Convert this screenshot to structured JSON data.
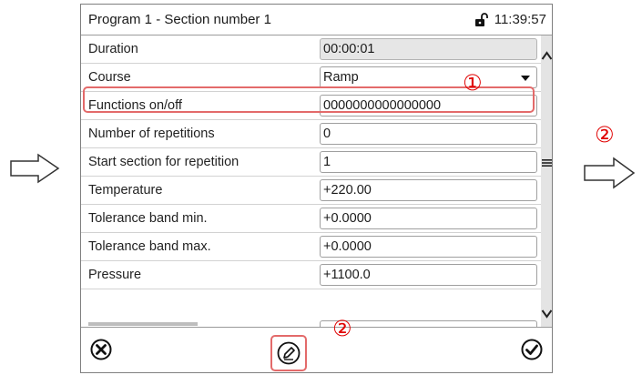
{
  "window": {
    "title": "Program 1 - Section number 1",
    "time": "11:39:57"
  },
  "rows": [
    {
      "label": "Duration",
      "value": "00:00:01"
    },
    {
      "label": "Course",
      "value": "Ramp"
    },
    {
      "label": "Functions on/off",
      "value": "0000000000000000"
    },
    {
      "label": "Number of repetitions",
      "value": "0"
    },
    {
      "label": "Start section for repetition",
      "value": "1"
    },
    {
      "label": "Temperature",
      "value": "+220.00"
    },
    {
      "label": "Tolerance band min.",
      "value": "+0.0000"
    },
    {
      "label": "Tolerance band max.",
      "value": "+0.0000"
    },
    {
      "label": "Pressure",
      "value": "+1100.0"
    }
  ],
  "annotations": {
    "marker_1": "①",
    "marker_2": "②"
  },
  "icons": {
    "lock": "lock-icon",
    "scroll_up": "chevron-up-icon",
    "scroll_menu": "menu-icon",
    "scroll_down": "chevron-down-icon",
    "cancel": "close-circle-icon",
    "edit": "edit-pencil-icon",
    "confirm": "check-circle-icon",
    "arrow": "right-arrow-icon"
  },
  "colors": {
    "highlight": "#e36a6a",
    "marker": "#e00000",
    "readonly_field": "#e6e6e6",
    "scrollbar": "#e4e4e4"
  }
}
